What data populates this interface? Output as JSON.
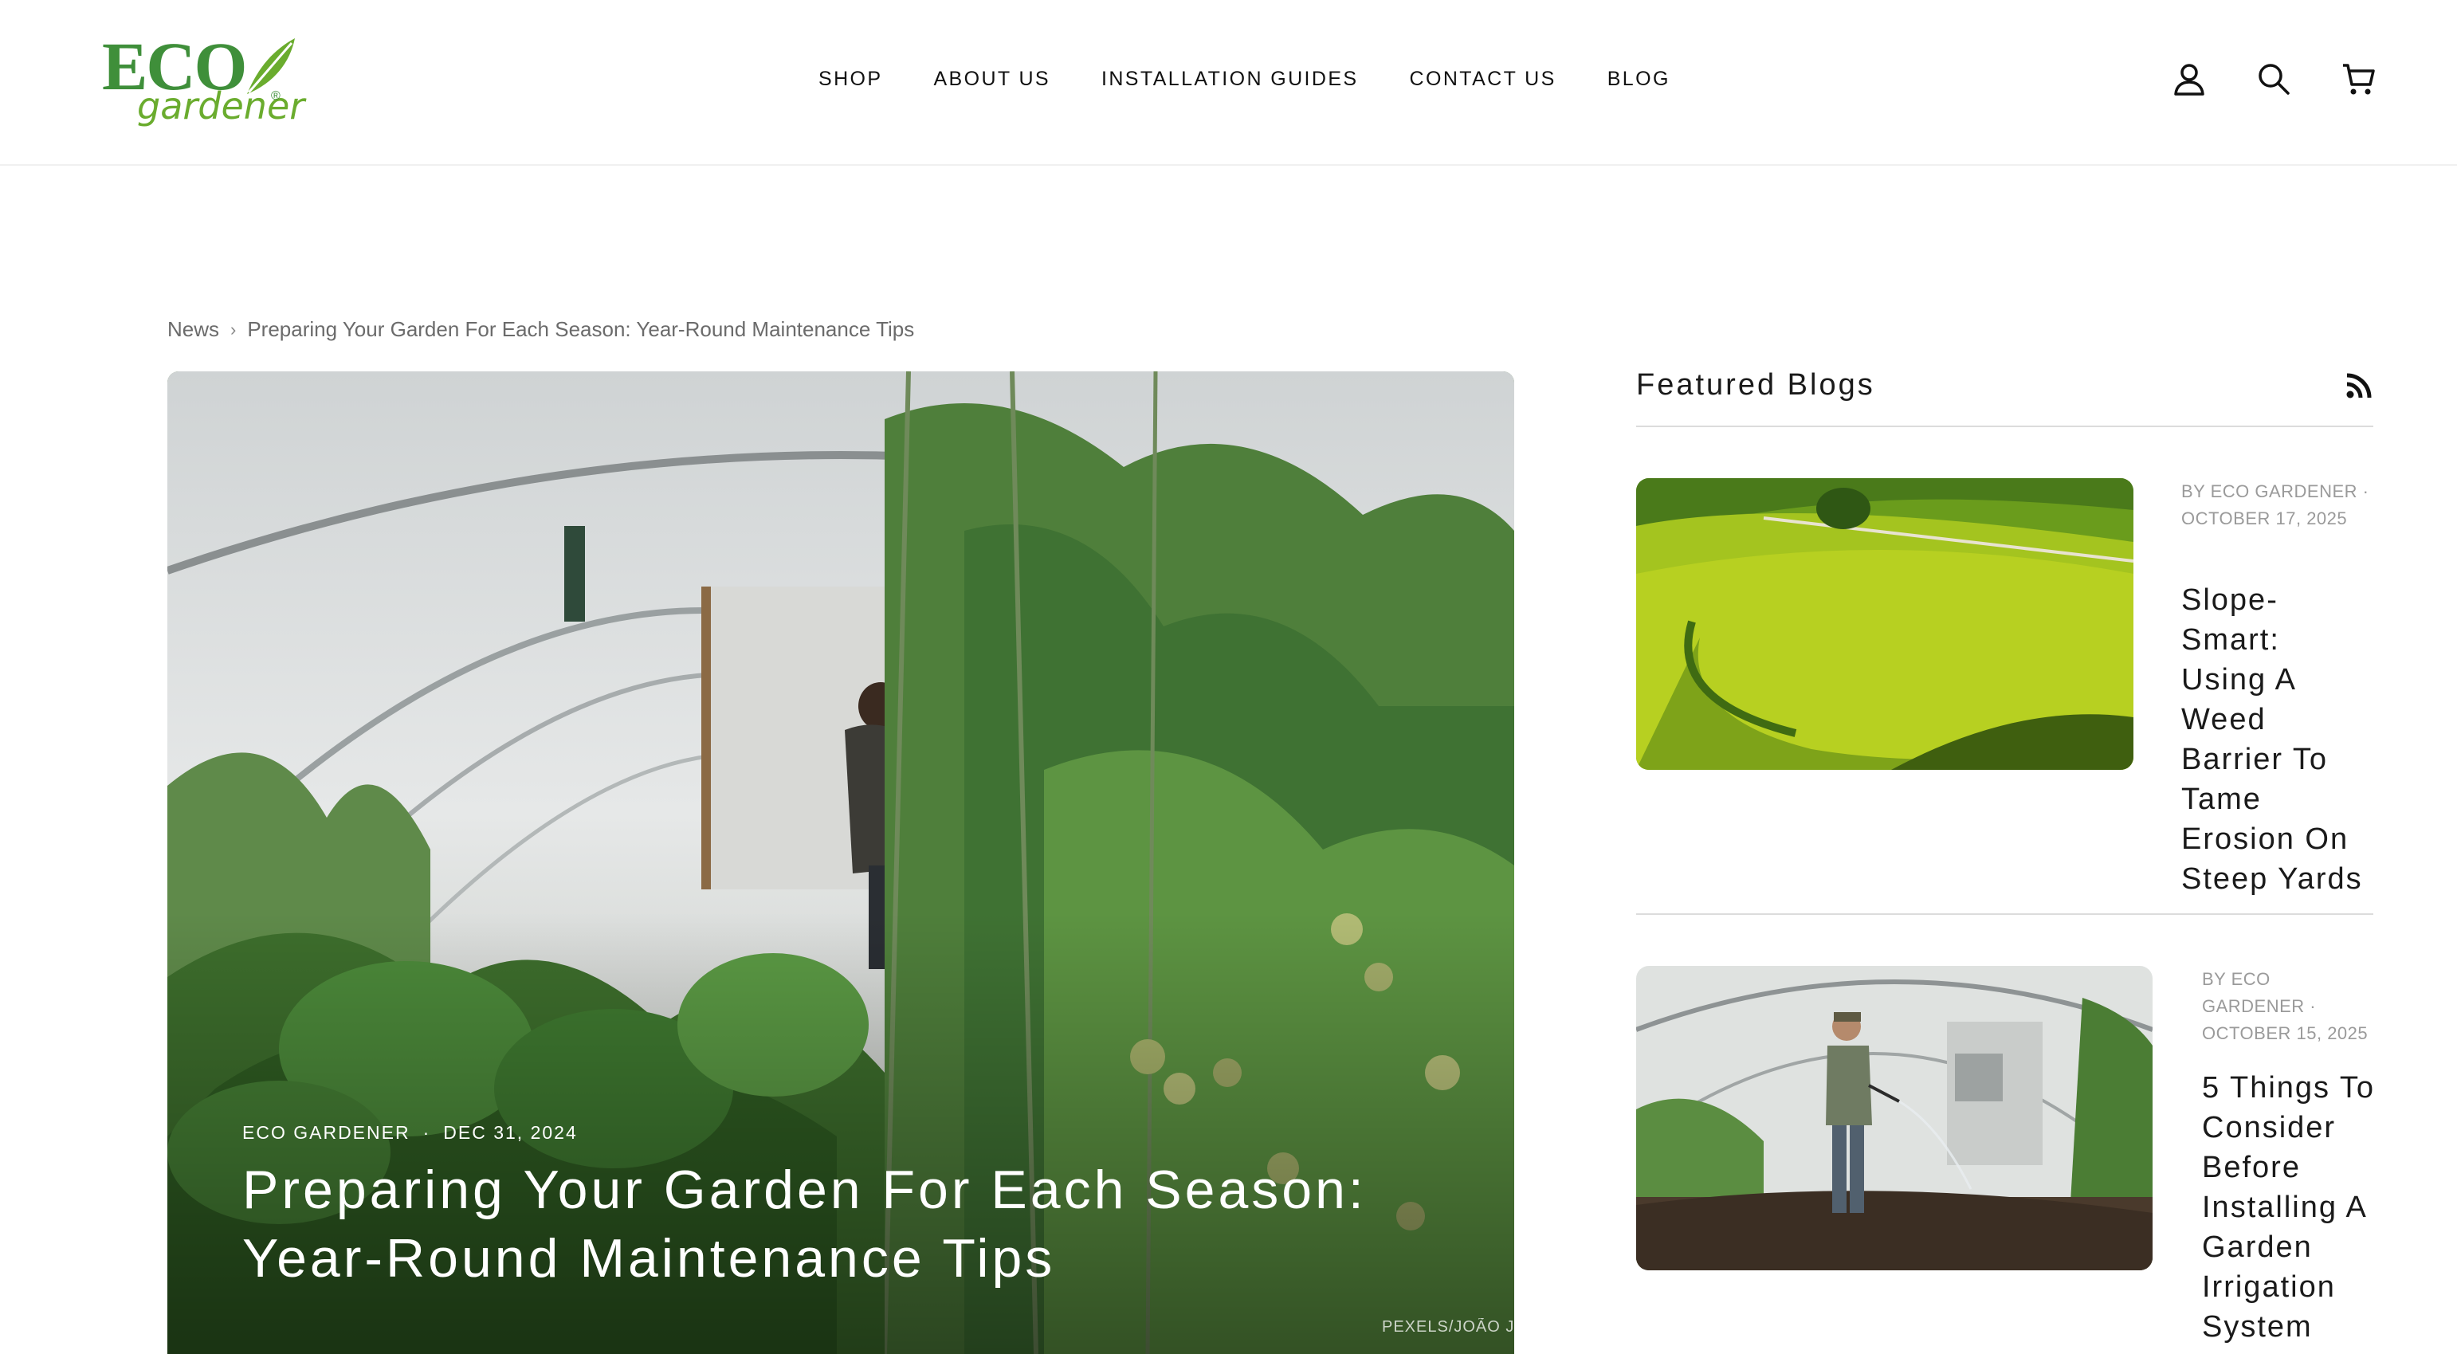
{
  "brand": {
    "logo_word": "ECO",
    "logo_sub": "gardener",
    "logo_mark": "®",
    "accent": "#3f8f3a",
    "leaf": "#6aac2e"
  },
  "nav": {
    "items": [
      "SHOP",
      "ABOUT US",
      "INSTALLATION GUIDES",
      "CONTACT US",
      "BLOG"
    ]
  },
  "header_icons": [
    "account-icon",
    "search-icon",
    "cart-icon"
  ],
  "breadcrumb": {
    "root": "News",
    "separator": "›",
    "current": "Preparing Your Garden For Each Season: Year-Round Maintenance Tips"
  },
  "hero": {
    "author": "ECO GARDENER",
    "dot": "·",
    "date": "DEC 31, 2024",
    "title": "Preparing Your Garden For Each Season: Year-Round Maintenance Tips",
    "credit": "PEXELS/JOÃO J"
  },
  "sidebar": {
    "heading": "Featured Blogs",
    "posts": [
      {
        "byline": "BY ECO GARDENER · OCTOBER 17, 2025",
        "title": "Slope-Smart: Using A Weed Barrier To Tame Erosion On Steep Yards",
        "image": "green sloped field"
      },
      {
        "byline": "BY ECO GARDENER · OCTOBER 15, 2025",
        "title": "5 Things To Consider Before Installing A Garden Irrigation System",
        "image": "greenhouse watering"
      }
    ]
  }
}
